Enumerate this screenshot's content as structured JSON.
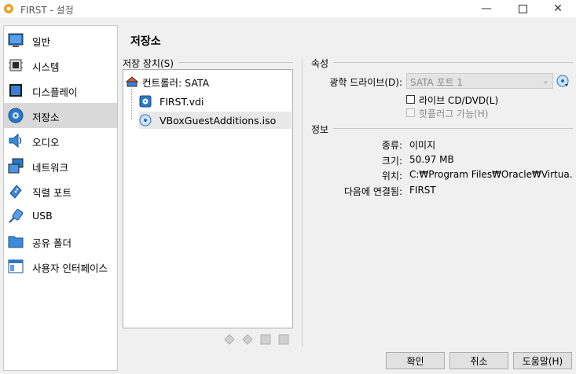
{
  "window": {
    "title": "FIRST - 설정",
    "minimize_icon": "minimize-icon",
    "maximize_icon": "maximize-icon",
    "close_icon": "close-icon"
  },
  "sidebar": {
    "items": [
      {
        "label": "일반",
        "icon": "general-icon"
      },
      {
        "label": "시스템",
        "icon": "system-icon"
      },
      {
        "label": "디스플레이",
        "icon": "display-icon"
      },
      {
        "label": "저장소",
        "icon": "storage-icon",
        "selected": true
      },
      {
        "label": "오디오",
        "icon": "audio-icon"
      },
      {
        "label": "네트워크",
        "icon": "network-icon"
      },
      {
        "label": "직렬 포트",
        "icon": "serial-port-icon"
      },
      {
        "label": "USB",
        "icon": "usb-icon"
      },
      {
        "label": "공유 폴더",
        "icon": "shared-folder-icon"
      },
      {
        "label": "사용자 인터페이스",
        "icon": "user-interface-icon"
      }
    ]
  },
  "page": {
    "title": "저장소"
  },
  "storage": {
    "header": "저장 장치(S)",
    "controller": "컨트롤러: SATA",
    "attachments": [
      {
        "label": "FIRST.vdi",
        "icon": "hard-disk-icon"
      },
      {
        "label": "VBoxGuestAdditions.iso",
        "icon": "optical-disc-icon",
        "selected": true
      }
    ]
  },
  "attributes": {
    "header": "속성",
    "drive_label": "광학 드라이브(D):",
    "drive_value": "SATA 포트 1",
    "live_cd_label": "라이브 CD/DVD(L)",
    "hotplug_label": "핫플러그 가능(H)"
  },
  "info": {
    "header": "정보",
    "rows": [
      {
        "label": "종류:",
        "value": "이미지"
      },
      {
        "label": "크기:",
        "value": "50.97 MB"
      },
      {
        "label": "위치:",
        "value": "C:₩Program Files₩Oracle₩Virtua..."
      },
      {
        "label": "다음에 연결됨:",
        "value": "FIRST"
      }
    ]
  },
  "buttons": {
    "ok": "확인",
    "cancel": "취소",
    "help": "도움말(H)"
  },
  "colors": {
    "accent_blue": "#1e6fc9",
    "selection_gray": "#d9d9d9"
  }
}
